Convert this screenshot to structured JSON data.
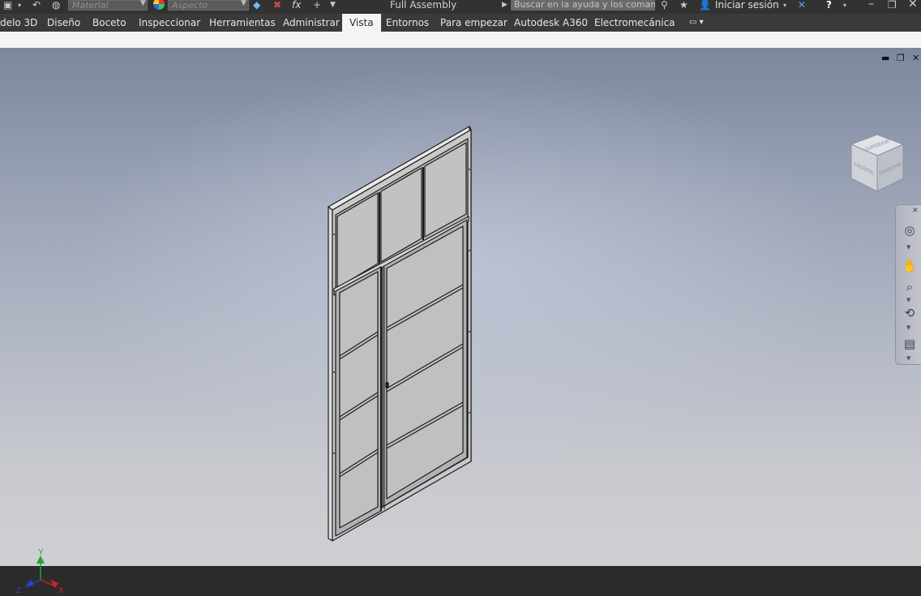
{
  "quick_access": {
    "material_placeholder": "Material",
    "appearance_placeholder": "Aspecto",
    "fx_label": "fx",
    "document_title": "Full Assembly",
    "search_placeholder": "Buscar en la ayuda y los comanc",
    "signin_label": "Iniciar sesión",
    "help_label": "?"
  },
  "ribbon": {
    "tabs": [
      {
        "label": "delo 3D",
        "active": false
      },
      {
        "label": "Diseño",
        "active": false
      },
      {
        "label": "Boceto",
        "active": false
      },
      {
        "label": "Inspeccionar",
        "active": false
      },
      {
        "label": "Herramientas",
        "active": false
      },
      {
        "label": "Administrar",
        "active": false
      },
      {
        "label": "Vista",
        "active": true
      },
      {
        "label": "Entornos",
        "active": false
      },
      {
        "label": "Para empezar",
        "active": false
      },
      {
        "label": "Autodesk A360",
        "active": false
      },
      {
        "label": "Electromecánica",
        "active": false
      }
    ]
  },
  "viewcube": {
    "top_label": "SUPERIOR",
    "front_label": "FRONTAL",
    "right_label": "DERECHA"
  },
  "triad": {
    "x_label": "X",
    "y_label": "Y",
    "z_label": "Z"
  },
  "colors": {
    "active_tab_bg": "#f4f4f4",
    "ribbon_bg": "#3a3a3a",
    "axis_x": "#d0202a",
    "axis_y": "#1fa33a",
    "axis_z": "#2b3fd0"
  },
  "icons": [
    "save-icon",
    "undo-icon",
    "material-icon",
    "appearance-icon",
    "fx-icon",
    "plus-icon",
    "signin-icon",
    "star-icon",
    "exchange-icon",
    "help-icon",
    "minimize-icon",
    "restore-icon",
    "close-icon",
    "orbit-icon",
    "pan-icon",
    "zoom-icon",
    "look-icon",
    "viewface-icon"
  ]
}
